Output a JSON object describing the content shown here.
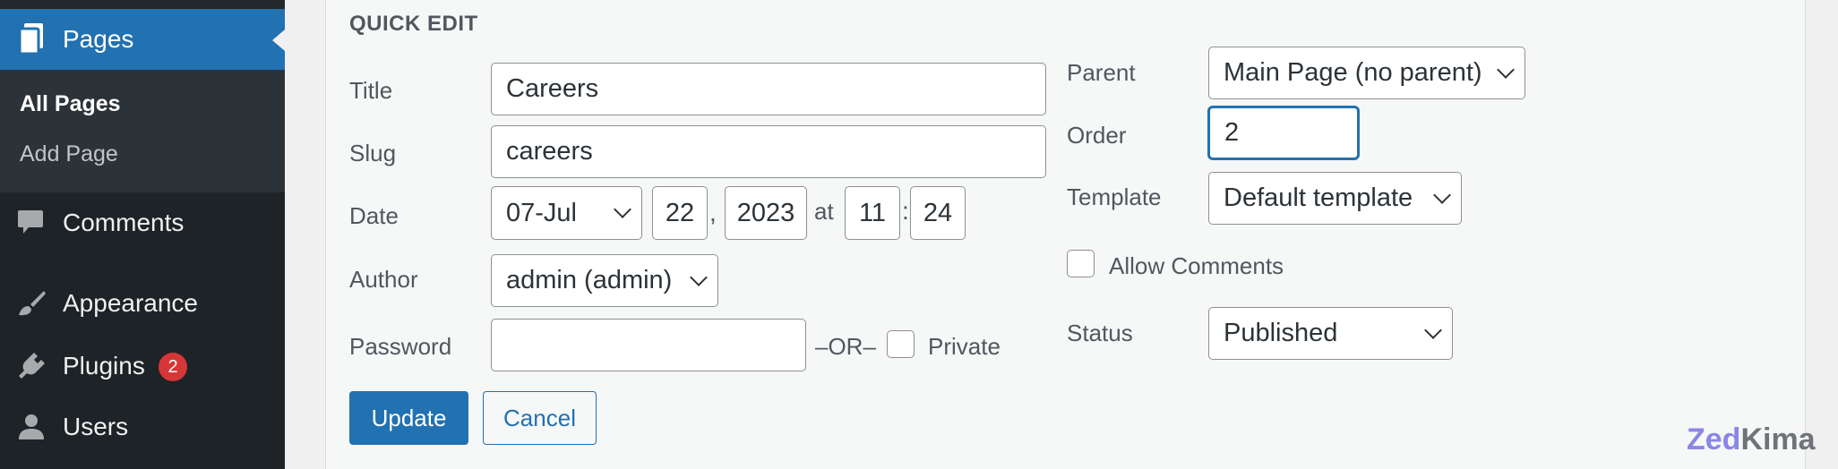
{
  "sidebar": {
    "pages_label": "Pages",
    "submenu": [
      "All Pages",
      "Add Page"
    ],
    "comments_label": "Comments",
    "appearance_label": "Appearance",
    "plugins_label": "Plugins",
    "plugins_badge": "2",
    "users_label": "Users"
  },
  "quick_edit": {
    "heading": "QUICK EDIT",
    "title_label": "Title",
    "title_value": "Careers",
    "slug_label": "Slug",
    "slug_value": "careers",
    "date_label": "Date",
    "date_month": "07-Jul",
    "date_day": "22",
    "date_comma": ",",
    "date_year": "2023",
    "date_at": "at",
    "date_hour": "11",
    "date_colon": ":",
    "date_minute": "24",
    "author_label": "Author",
    "author_value": "admin (admin)",
    "password_label": "Password",
    "password_value": "",
    "or_label": "–OR–",
    "private_label": "Private",
    "parent_label": "Parent",
    "parent_value": "Main Page (no parent)",
    "order_label": "Order",
    "order_value": "2",
    "template_label": "Template",
    "template_value": "Default template",
    "allow_comments_label": "Allow Comments",
    "status_label": "Status",
    "status_value": "Published",
    "update_label": "Update",
    "cancel_label": "Cancel"
  },
  "watermark": {
    "part1": "Zed",
    "part2": "Kima"
  },
  "colors": {
    "sidebar_bg": "#1d2327",
    "accent": "#2271b1",
    "badge": "#d63638"
  }
}
